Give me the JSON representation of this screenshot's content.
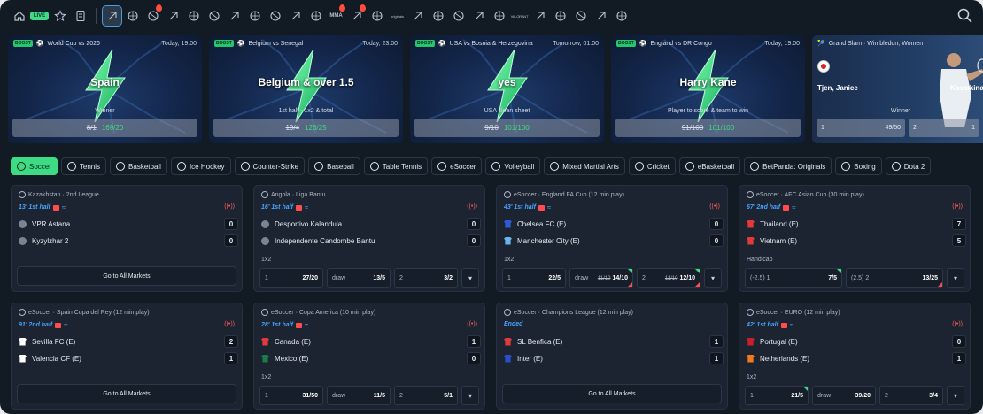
{
  "nav": {
    "live_label": "LIVE",
    "items": [
      "home-icon",
      "live-badge",
      "star-icon",
      "betslip-icon",
      "sep",
      "esports-icon",
      "horse-racing-icon",
      "soccer-icon",
      "tennis-icon",
      "basketball-icon",
      "hockey-icon",
      "counter-strike-icon",
      "baseball-icon",
      "table-tennis-icon",
      "esoccer-icon",
      "volleyball-icon",
      "mma-icon",
      "cricket-icon",
      "ebasketball-icon",
      "originals-icon",
      "boxing-icon",
      "dota-icon",
      "flag-icon",
      "warning-icon",
      "rugby-icon",
      "valorant-icon",
      "cycling-icon",
      "darts-icon",
      "american-football-icon",
      "golf-icon",
      "more-icon"
    ],
    "search_icon": "search-icon",
    "mma_label": "MMA",
    "valorant_label": "VALORANT",
    "originals_label": "originals"
  },
  "banners": [
    {
      "boost": "BOOST",
      "event": "World Cup vs 2026",
      "date": "Today, 19:00",
      "title": "Spain",
      "subtitle": "Winner",
      "old_odds": "8/1",
      "new_odds": "169/20"
    },
    {
      "boost": "BOOST",
      "event": "Belgium vs Senegal",
      "date": "Today, 23:00",
      "title": "Belgium & over 1.5",
      "subtitle": "1st half - 1x2 & total",
      "old_odds": "19/4",
      "new_odds": "126/25"
    },
    {
      "boost": "BOOST",
      "event": "USA vs Bosnia & Herzegovina",
      "date": "Tomorrow, 01:00",
      "title": "yes",
      "subtitle": "USA clean sheet",
      "old_odds": "9/10",
      "new_odds": "101/100"
    },
    {
      "boost": "BOOST",
      "event": "England vs DR Congo",
      "date": "Today, 19:00",
      "title": "Harry Kane",
      "subtitle": "Player to score & team to win",
      "old_odds": "91/100",
      "new_odds": "101/100"
    }
  ],
  "banner5": {
    "event": "Grand Slam · Wimbledon, Women",
    "player1": "Tjen, Janice",
    "player2": "Kasatkina,",
    "subtitle": "Winner",
    "odds": [
      {
        "label": "1",
        "value": "49/50"
      },
      {
        "label": "2",
        "value": "1"
      }
    ]
  },
  "tabs": [
    "Soccer",
    "Tennis",
    "Basketball",
    "Ice Hockey",
    "Counter-Strike",
    "Baseball",
    "Table Tennis",
    "eSoccer",
    "Volleyball",
    "Mixed Martial Arts",
    "Cricket",
    "eBasketball",
    "BetPanda: Originals",
    "Boxing",
    "Dota 2"
  ],
  "cards": [
    {
      "league": "Kazakhstan · 2nd League",
      "status": "13' 1st half",
      "home": "VPR Astana",
      "away": "Kyzylzhar 2",
      "hs": "0",
      "as": "0",
      "type": "go",
      "go": "Go to All Markets"
    },
    {
      "league": "Angola · Liga Bantu",
      "status": "16' 1st half",
      "home": "Desportivo Kalandula",
      "away": "Independente Candombe Bantu",
      "hs": "0",
      "as": "0",
      "type": "odds",
      "market": "1x2",
      "odds": [
        {
          "l": "1",
          "v": "27/20"
        },
        {
          "l": "draw",
          "v": "13/5"
        },
        {
          "l": "2",
          "v": "3/2"
        }
      ]
    },
    {
      "league": "eSoccer · England FA Cup (12 min play)",
      "status": "43' 1st half",
      "home": "Chelsea FC (E)",
      "away": "Manchester City (E)",
      "hs": "0",
      "as": "0",
      "type": "odds",
      "market": "1x2",
      "odds": [
        {
          "l": "1",
          "v": "22/5"
        },
        {
          "l": "draw",
          "v": "14/10",
          "o": "11/10"
        },
        {
          "l": "2",
          "v": "12/10",
          "o": "11/10"
        }
      ]
    },
    {
      "league": "eSoccer · AFC Asian Cup (30 min play)",
      "status": "67' 2nd half",
      "home": "Thailand (E)",
      "away": "Vietnam (E)",
      "hs": "7",
      "as": "5",
      "type": "odds",
      "market": "Handicap",
      "odds": [
        {
          "l": "(-2.5) 1",
          "v": "7/5"
        },
        {
          "l": "(2.5) 2",
          "v": "13/25"
        }
      ]
    },
    {
      "league": "eSoccer · Spain Copa del Rey (12 min play)",
      "status": "91' 2nd half",
      "home": "Sevilla FC (E)",
      "away": "Valencia CF (E)",
      "hs": "2",
      "as": "1",
      "type": "go",
      "go": "Go to All Markets"
    },
    {
      "league": "eSoccer · Copa America (10 min play)",
      "status": "28' 1st half",
      "home": "Canada (E)",
      "away": "Mexico (E)",
      "hs": "1",
      "as": "0",
      "type": "odds",
      "market": "1x2",
      "odds": [
        {
          "l": "1",
          "v": "31/50"
        },
        {
          "l": "draw",
          "v": "11/5"
        },
        {
          "l": "2",
          "v": "5/1"
        }
      ]
    },
    {
      "league": "eSoccer · Champions League (12 min play)",
      "status": "Ended",
      "home": "SL Benfica (E)",
      "away": "Inter (E)",
      "hs": "1",
      "as": "1",
      "type": "go",
      "go": "Go to All Markets"
    },
    {
      "league": "eSoccer · EURO (12 min play)",
      "status": "42' 1st half",
      "home": "Portugal (E)",
      "away": "Netherlands (E)",
      "hs": "0",
      "as": "1",
      "type": "odds",
      "market": "1x2",
      "odds": [
        {
          "l": "1",
          "v": "21/5"
        },
        {
          "l": "draw",
          "v": "39/20"
        },
        {
          "l": "2",
          "v": "3/4"
        }
      ]
    }
  ],
  "colors": {
    "accent": "#3ddc84",
    "live_blue": "#4aa3ff",
    "bg": "#121a24",
    "card": "#1b2430"
  }
}
